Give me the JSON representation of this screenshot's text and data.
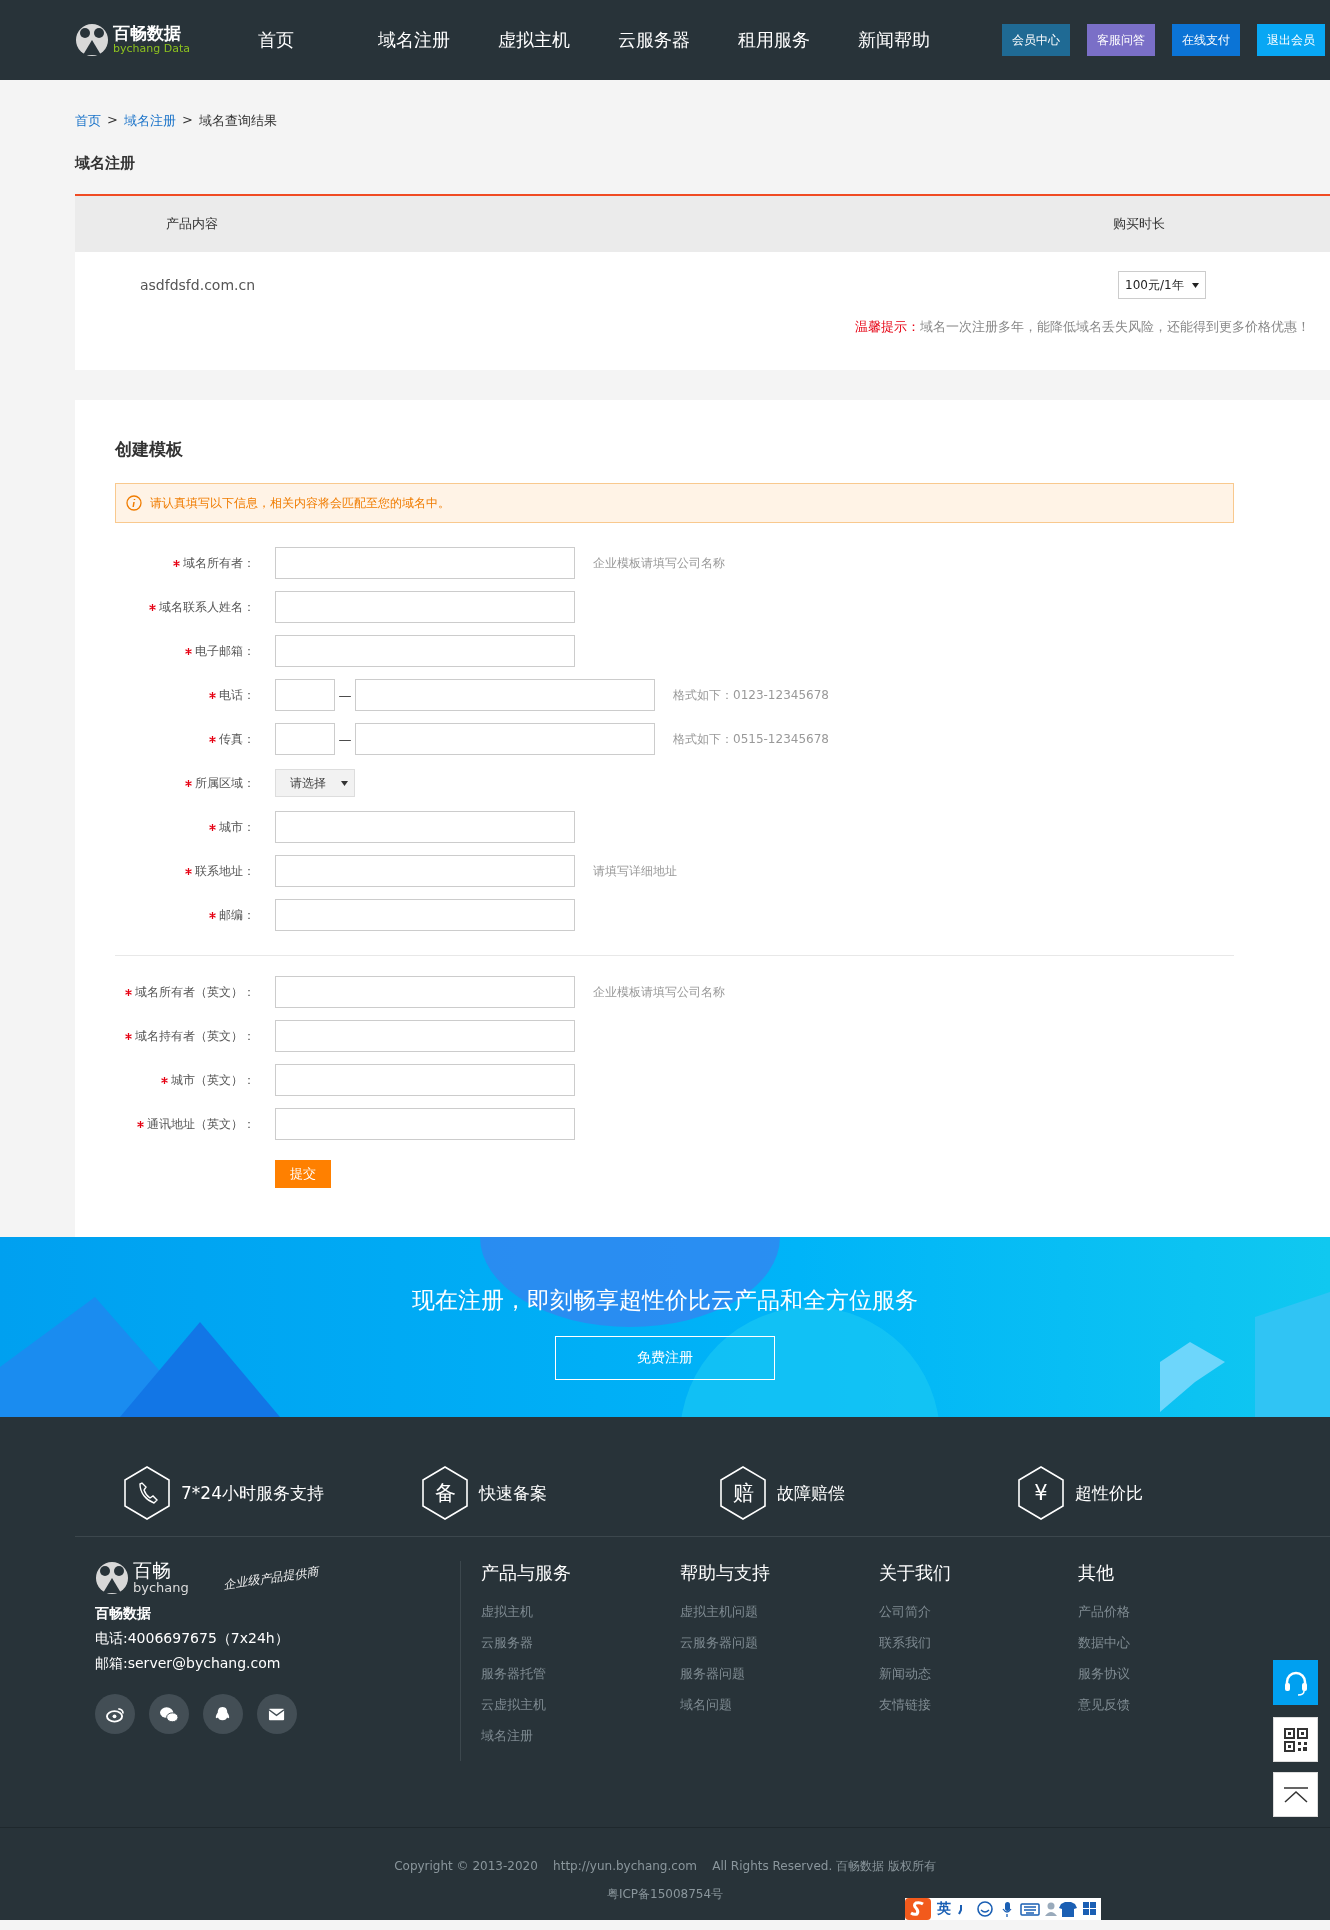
{
  "header": {
    "logo": {
      "name": "百畅数据",
      "sub": "bychang Data"
    },
    "nav": [
      "首页",
      "域名注册",
      "虚拟主机",
      "云服务器",
      "租用服务",
      "新闻帮助"
    ],
    "buttons": [
      {
        "label": "会员中心",
        "color": "#1f6a94"
      },
      {
        "label": "客服问答",
        "color": "#7a6fc7"
      },
      {
        "label": "在线支付",
        "color": "#0b74d6"
      },
      {
        "label": "退出会员",
        "color": "#08a7f4"
      }
    ]
  },
  "breadcrumb": [
    {
      "label": "首页",
      "kind": "link"
    },
    {
      "label": ">",
      "kind": "sep"
    },
    {
      "label": "域名注册",
      "kind": "link"
    },
    {
      "label": ">",
      "kind": "sep"
    },
    {
      "label": "域名查询结果",
      "kind": "current"
    }
  ],
  "section_title": "域名注册",
  "product_table": {
    "columns": [
      "产品内容",
      "购买时长"
    ],
    "rows": [
      {
        "domain": "asdfdsfd.com.cn",
        "duration": "100元/1年"
      }
    ],
    "tip": {
      "label": "温馨提示：",
      "text": "域名一次注册多年，能降低域名丢失风险，还能得到更多价格优惠！"
    }
  },
  "template_form": {
    "title": "创建模板",
    "notice": "请认真填写以下信息，相关内容将会匹配至您的域名中。",
    "groups": [
      [
        {
          "kind": "text",
          "label": "域名所有者：",
          "required": true,
          "hint": "企业模板请填写公司名称"
        },
        {
          "kind": "text",
          "label": "域名联系人姓名：",
          "required": true
        },
        {
          "kind": "text",
          "label": "电子邮箱：",
          "required": true
        },
        {
          "kind": "phone",
          "label": "电话：",
          "required": true,
          "separator": "—",
          "hint": "格式如下：0123-12345678"
        },
        {
          "kind": "phone",
          "label": "传真：",
          "required": true,
          "separator": "—",
          "hint": "格式如下：0515-12345678"
        },
        {
          "kind": "select",
          "label": "所属区域：",
          "required": true,
          "value": "请选择"
        },
        {
          "kind": "text",
          "label": "城市：",
          "required": true
        },
        {
          "kind": "text",
          "label": "联系地址：",
          "required": true,
          "hint": "请填写详细地址"
        },
        {
          "kind": "text",
          "label": "邮编：",
          "required": true
        }
      ],
      [
        {
          "kind": "text",
          "label": "域名所有者（英文）：",
          "required": true,
          "hint": "企业模板请填写公司名称"
        },
        {
          "kind": "text",
          "label": "域名持有者（英文）：",
          "required": true
        },
        {
          "kind": "text",
          "label": "城市（英文）：",
          "required": true
        },
        {
          "kind": "text",
          "label": "通讯地址（英文）：",
          "required": true
        }
      ]
    ],
    "submit": "提交"
  },
  "banner": {
    "headline": "现在注册，即刻畅享超性价比云产品和全方位服务",
    "button": "免费注册"
  },
  "features": [
    {
      "kind": "phone",
      "label": "7*24小时服务支持"
    },
    {
      "kind": "glyph",
      "glyph": "备",
      "label": "快速备案"
    },
    {
      "kind": "glyph",
      "glyph": "赔",
      "label": "故障赔偿"
    },
    {
      "kind": "glyph",
      "glyph": "¥",
      "label": "超性价比"
    }
  ],
  "footer": {
    "brand": {
      "name": "百畅",
      "sub": "bychang",
      "slogan": "企业级产品提供商",
      "company": "百畅数据",
      "phone": "电话:4006697675（7x24h）",
      "email": "邮箱:server@bychang.com"
    },
    "columns": [
      {
        "title": "产品与服务",
        "links": [
          "虚拟主机",
          "云服务器",
          "服务器托管",
          "云虚拟主机",
          "域名注册"
        ]
      },
      {
        "title": "帮助与支持",
        "links": [
          "虚拟主机问题",
          "云服务器问题",
          "服务器问题",
          "域名问题"
        ]
      },
      {
        "title": "关于我们",
        "links": [
          "公司简介",
          "联系我们",
          "新闻动态",
          "友情链接"
        ]
      },
      {
        "title": "其他",
        "links": [
          "产品价格",
          "数据中心",
          "服务协议",
          "意见反馈"
        ]
      }
    ],
    "copyright": "Copyright © 2013-2020    http://yun.bychang.com    All Rights Reserved. 百畅数据 版权所有",
    "icp": "粤ICP备15008754号"
  },
  "ime": {
    "mode": "英"
  }
}
